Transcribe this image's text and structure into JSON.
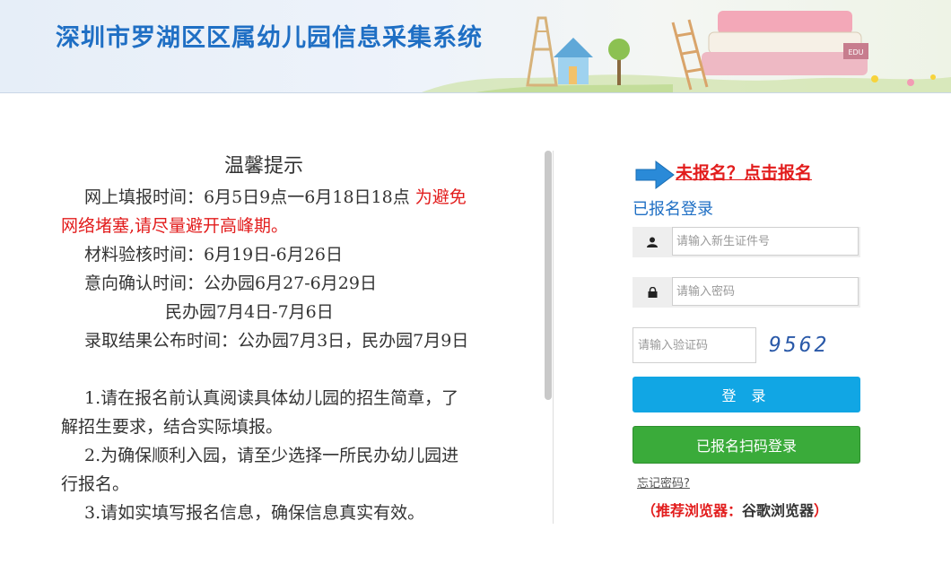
{
  "header": {
    "title": "深圳市罗湖区区属幼儿园信息采集系统",
    "book_label": "EDU"
  },
  "notice": {
    "title": "温馨提示",
    "p1_normal": "网上填报时间：6月5日9点一6月18日18点 ",
    "p1_red": "为避免网络堵塞,请尽量避开高峰期。",
    "p2": "材料验核时间：6月19日-6月26日",
    "p3": "意向确认时间：公办园6月27-6月29日",
    "p4": "民办园7月4日-7月6日",
    "p5": "录取结果公布时间：公办园7月3日，民办园7月9日",
    "p6": "1.请在报名前认真阅读具体幼儿园的招生简章，了解招生要求，结合实际填报。",
    "p7": "2.为确保顺利入园，请至少选择一所民办幼儿园进行报名。",
    "p8": "3.请如实填写报名信息，确保信息真实有效。"
  },
  "login": {
    "register_link": "未报名？点击报名",
    "section_title": "已报名登录",
    "id_placeholder": "请输入新生证件号",
    "password_placeholder": "请输入密码",
    "captcha_placeholder": "请输入验证码",
    "captcha_code": "9562",
    "login_button": "登 录",
    "scan_button": "已报名扫码登录",
    "forgot_password": "忘记密码?",
    "browser_open": "（",
    "browser_label": "推荐浏览器：",
    "browser_value": "谷歌浏览器",
    "browser_close": "）"
  },
  "colors": {
    "brand_blue": "#1f6fc4",
    "alert_red": "#e21c1c",
    "login_button": "#11a6e4",
    "scan_button": "#3aab3a"
  },
  "icons": [
    "user-icon",
    "lock-icon",
    "arrow-right-icon"
  ]
}
